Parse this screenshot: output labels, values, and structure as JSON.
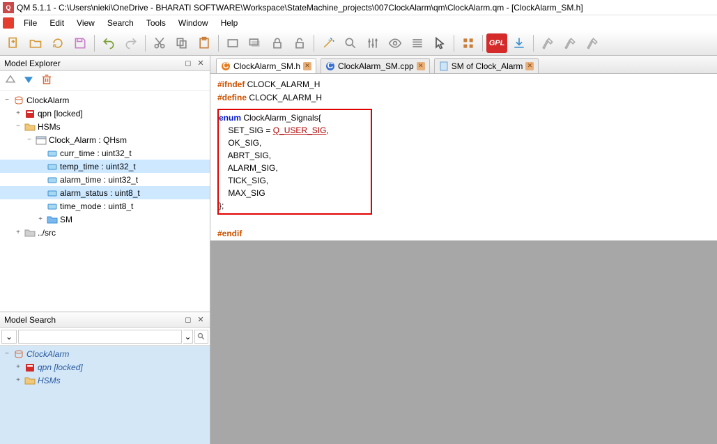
{
  "title": "QM 5.1.1 - C:\\Users\\nieki\\OneDrive - BHARATI SOFTWARE\\Workspace\\StateMachine_projects\\007ClockAlarm\\qm\\ClockAlarm.qm - [ClockAlarm_SM.h]",
  "menu": {
    "file": "File",
    "edit": "Edit",
    "view": "View",
    "search": "Search",
    "tools": "Tools",
    "window": "Window",
    "help": "Help"
  },
  "panels": {
    "explorer": "Model Explorer",
    "search": "Model Search"
  },
  "explorer_tree": {
    "root": "ClockAlarm",
    "items": [
      {
        "label": "qpn [locked]",
        "depth": 1,
        "tw": "+",
        "icon": "pkg-red"
      },
      {
        "label": "HSMs",
        "depth": 1,
        "tw": "−",
        "icon": "folder"
      },
      {
        "label": "Clock_Alarm : QHsm",
        "depth": 2,
        "tw": "−",
        "icon": "class"
      },
      {
        "label": "curr_time : uint32_t",
        "depth": 3,
        "tw": "",
        "icon": "attr"
      },
      {
        "label": "temp_time : uint32_t",
        "depth": 3,
        "tw": "",
        "icon": "attr",
        "sel": true
      },
      {
        "label": "alarm_time : uint32_t",
        "depth": 3,
        "tw": "",
        "icon": "attr"
      },
      {
        "label": "alarm_status : uint8_t",
        "depth": 3,
        "tw": "",
        "icon": "attr",
        "sel": true
      },
      {
        "label": "time_mode : uint8_t",
        "depth": 3,
        "tw": "",
        "icon": "attr"
      },
      {
        "label": "SM",
        "depth": 3,
        "tw": "+",
        "icon": "folder-blue"
      },
      {
        "label": "../src",
        "depth": 1,
        "tw": "+",
        "icon": "folder-gray"
      }
    ]
  },
  "search_tree": [
    {
      "label": "ClockAlarm",
      "depth": 0,
      "tw": "−",
      "icon": "pkg",
      "root": true
    },
    {
      "label": "qpn [locked]",
      "depth": 1,
      "tw": "+",
      "icon": "pkg-red",
      "italic": true
    },
    {
      "label": "HSMs",
      "depth": 1,
      "tw": "+",
      "icon": "folder",
      "italic": true
    }
  ],
  "tabs": [
    {
      "label": "ClockAlarm_SM.h",
      "icon": "c-orange",
      "active": true
    },
    {
      "label": "ClockAlarm_SM.cpp",
      "icon": "c-blue",
      "active": false
    },
    {
      "label": "SM of Clock_Alarm",
      "icon": "doc",
      "active": false
    }
  ],
  "code": {
    "l1a": "#ifndef",
    "l1b": " CLOCK_ALARM_H",
    "l2a": "#define",
    "l2b": " CLOCK_ALARM_H",
    "l3a": "enum",
    "l3b": " ClockAlarm_Signals{",
    "l4a": "    SET_SIG = ",
    "l4b": "Q_USER_SIG",
    "l4c": ",",
    "l5": "    OK_SIG,",
    "l6": "    ABRT_SIG,",
    "l7": "    ALARM_SIG,",
    "l8": "    TICK_SIG,",
    "l9": "    MAX_SIG",
    "l10": "};",
    "l11": "#endif"
  },
  "search_input": {
    "placeholder": ""
  }
}
